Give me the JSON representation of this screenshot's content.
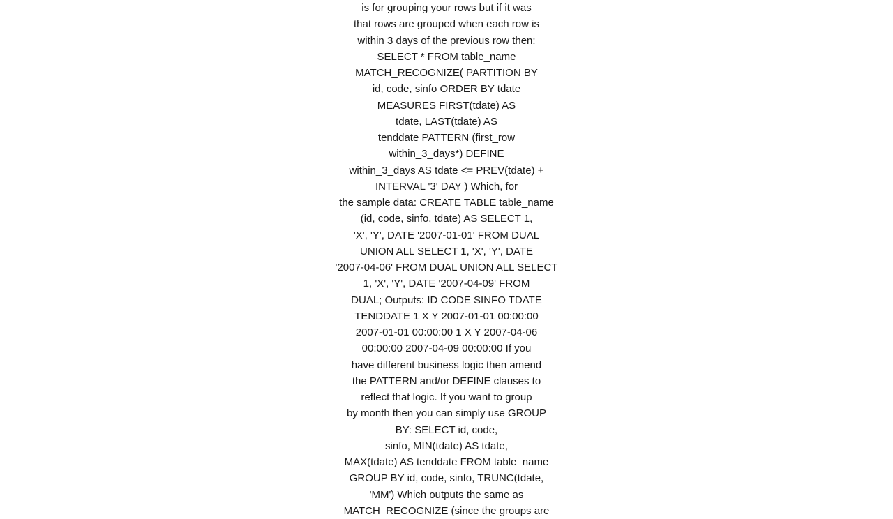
{
  "content": {
    "lines": [
      "is for grouping your rows but if it was",
      "that rows are grouped when each row is",
      "within 3 days of the previous row then:",
      "SELECT * FROM   table_name",
      "MATCH_RECOGNIZE(        PARTITION BY",
      "id, code, sinfo        ORDER BY tdate",
      "MEASURES        FIRST(tdate) AS",
      "tdate,        LAST(tdate) AS",
      "tenddate        PATTERN (first_row",
      "within_3_days*)        DEFINE",
      "within_3_days AS tdate <= PREV(tdate) +",
      "INTERVAL '3' DAY        )  Which, for",
      "the sample data: CREATE TABLE table_name",
      "(id, code, sinfo, tdate) AS SELECT 1,",
      "'X', 'Y', DATE '2007-01-01' FROM DUAL",
      "UNION ALL SELECT 1, 'X', 'Y', DATE",
      "'2007-04-06' FROM DUAL UNION ALL SELECT",
      "1, 'X', 'Y', DATE '2007-04-09' FROM",
      "DUAL;  Outputs:    ID CODE SINFO TDATE",
      "TENDDATE    1 X Y 2007-01-01 00:00:00",
      "2007-01-01 00:00:00   1 X Y 2007-04-06",
      "00:00:00 2007-04-09 00:00:00    If you",
      "have different business logic then amend",
      "the PATTERN and/or DEFINE clauses to",
      "reflect that logic. If you want to group",
      "by month then you can simply use GROUP",
      "BY: SELECT id,        code,",
      "sinfo,      MIN(tdate) AS tdate,",
      "MAX(tdate) AS tenddate FROM   table_name",
      "GROUP BY id, code, sinfo, TRUNC(tdate,",
      "'MM')  Which outputs the same as",
      "MATCH_RECOGNIZE (since the groups are"
    ]
  }
}
